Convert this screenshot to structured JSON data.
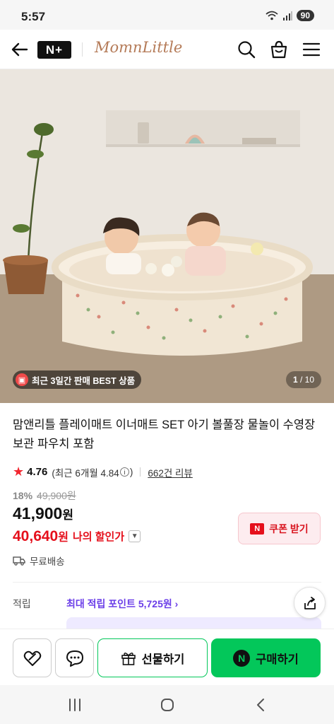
{
  "status_bar": {
    "time": "5:57",
    "battery": "90"
  },
  "header": {
    "badge": "N+",
    "brand": "MomnLittle"
  },
  "hero": {
    "badge_text": "최근 3일간 판매 BEST 상품",
    "page_current": "1",
    "page_total": "/ 10"
  },
  "product": {
    "title": "맘앤리틀 플레이매트 이너매트 SET 아기 볼풀장 물놀이 수영장 보관 파우치 포함",
    "rating": "4.76",
    "rating_recent": "(최근 6개월 4.84",
    "rating_recent_close": ")",
    "review_count": "662건 리뷰",
    "discount_rate": "18%",
    "original_price": "49,900원",
    "price": "41,900",
    "price_unit": "원",
    "my_price": "40,640",
    "my_price_unit": "원",
    "my_price_label": "나의 할인가",
    "coupon_label": "쿠폰 받기",
    "shipping": "무료배송"
  },
  "points": {
    "label": "적립",
    "value": "최대 적립 포인트 5,725원 ›"
  },
  "bottom_bar": {
    "gift_label": "선물하기",
    "buy_label": "구매하기"
  },
  "colors": {
    "naver_green": "#03c75a",
    "accent_red": "#e5101c",
    "points_purple": "#6b3ee8"
  }
}
